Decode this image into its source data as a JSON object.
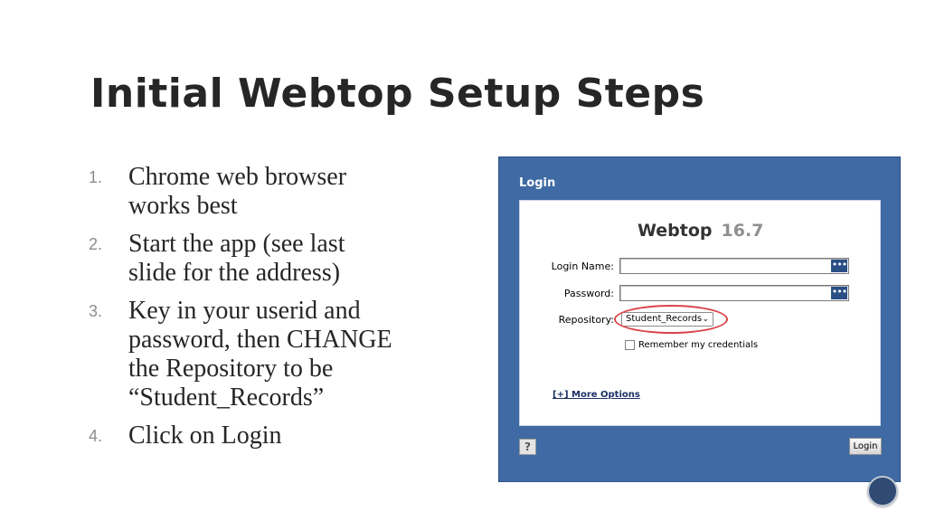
{
  "slide": {
    "title": "Initial Webtop Setup Steps",
    "steps": [
      {
        "number": "1.",
        "lines": [
          "Chrome web browser",
          "works best"
        ]
      },
      {
        "number": "2.",
        "lines": [
          "Start the app (see last",
          "slide for the address)"
        ]
      },
      {
        "number": "3.",
        "lines": [
          "Key in your userid and",
          "password, then CHANGE",
          "the Repository to be",
          "“Student_Records”"
        ]
      },
      {
        "number": "4.",
        "lines": [
          "Click on Login"
        ]
      }
    ]
  },
  "login": {
    "header": "Login",
    "product_name": "Webtop",
    "product_version": "16.7",
    "login_name_label": "Login Name:",
    "login_name_value": "",
    "password_label": "Password:",
    "password_value": "",
    "dots_label": "•••",
    "repository_label": "Repository:",
    "repository_selected": "Student_Records",
    "remember_label": "Remember my credentials",
    "more_options": "[+] More Options",
    "help_label": "?",
    "login_button": "Login"
  },
  "colors": {
    "window_blue": "#3f6aa3",
    "highlight_red": "#d9434a",
    "dots_button": "#2a4f86"
  }
}
